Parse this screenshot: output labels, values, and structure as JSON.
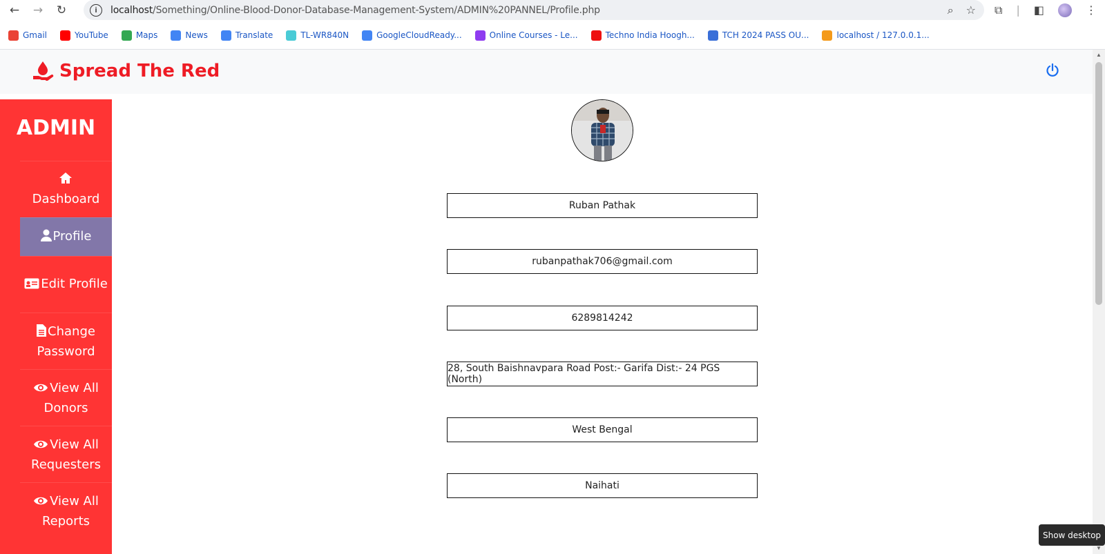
{
  "browser": {
    "url_host": "localhost",
    "url_path": "/Something/Online-Blood-Donor-Database-Management-System/ADMIN%20PANNEL/Profile.php",
    "bookmarks": [
      {
        "label": "Gmail",
        "icon": "gmail-icon",
        "color": "#ea4335"
      },
      {
        "label": "YouTube",
        "icon": "youtube-icon",
        "color": "#ff0000"
      },
      {
        "label": "Maps",
        "icon": "maps-icon",
        "color": "#34a853"
      },
      {
        "label": "News",
        "icon": "news-icon",
        "color": "#4285f4"
      },
      {
        "label": "Translate",
        "icon": "translate-icon",
        "color": "#4285f4"
      },
      {
        "label": "TL-WR840N",
        "icon": "tplink-icon",
        "color": "#4acbd6"
      },
      {
        "label": "GoogleCloudReady...",
        "icon": "google-icon",
        "color": "#4285f4"
      },
      {
        "label": "Online Courses - Le...",
        "icon": "courses-icon",
        "color": "#8f3cf0"
      },
      {
        "label": "Techno India Hoogh...",
        "icon": "techno-india-icon",
        "color": "#e11"
      },
      {
        "label": "TCH 2024 PASS OU...",
        "icon": "group-icon",
        "color": "#3a6fd8"
      },
      {
        "label": "localhost / 127.0.0.1...",
        "icon": "phpmyadmin-icon",
        "color": "#f49a1a"
      }
    ]
  },
  "header": {
    "brand": "Spread The Red",
    "brand_color": "#ee1c25"
  },
  "sidebar": {
    "title": "ADMIN",
    "items": [
      {
        "label": "Dashboard",
        "icon": "home-icon",
        "active": false
      },
      {
        "label": "Profile",
        "icon": "user-icon",
        "active": true
      },
      {
        "label": "Edit Profile",
        "icon": "id-card-icon",
        "active": false
      },
      {
        "label": "Change Password",
        "icon": "document-icon",
        "active": false
      },
      {
        "label": "View All Donors",
        "icon": "eye-icon",
        "active": false
      },
      {
        "label": "View All Requesters",
        "icon": "eye-icon",
        "active": false
      },
      {
        "label": "View All Reports",
        "icon": "eye-icon",
        "active": false
      }
    ]
  },
  "profile": {
    "name": "Ruban Pathak",
    "email": "rubanpathak706@gmail.com",
    "phone": "6289814242",
    "address": "28, South Baishnavpara Road Post:- Garifa Dist:- 24 PGS (North)",
    "state": "West Bengal",
    "city": "Naihati"
  },
  "tooltip": {
    "show_desktop": "Show desktop"
  }
}
